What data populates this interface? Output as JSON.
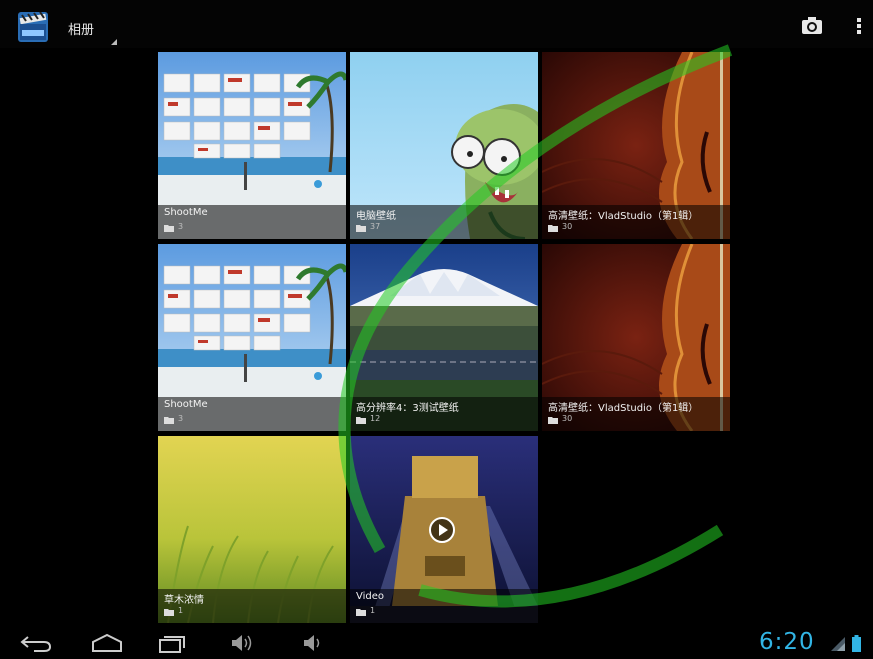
{
  "actionbar": {
    "title": "相册",
    "icons": {
      "app": "clapperboard-app-icon",
      "camera": "camera-icon",
      "overflow": "overflow-menu-icon"
    }
  },
  "albums": [
    {
      "title": "ShootMe",
      "count": "3",
      "art": "screenshot-beach"
    },
    {
      "title": "电脑壁纸",
      "count": "37",
      "art": "cartoon-robot"
    },
    {
      "title": "高清壁纸：VladStudio（第1辑）",
      "count": "30",
      "art": "violin"
    },
    {
      "title": "ShootMe",
      "count": "3",
      "art": "screenshot-beach"
    },
    {
      "title": "高分辨率4：3测试壁纸",
      "count": "12",
      "art": "mount-fuji"
    },
    {
      "title": "高清壁纸：VladStudio（第1辑）",
      "count": "30",
      "art": "violin"
    },
    {
      "title": "草木浓情",
      "count": "1",
      "art": "grass"
    },
    {
      "title": "Video",
      "count": "1",
      "art": "fox-logo",
      "is_video": true
    }
  ],
  "navbar": {
    "icons": [
      "back-icon",
      "home-icon",
      "recent-apps-icon",
      "volume-up-icon",
      "volume-down-icon"
    ],
    "clock": "6:20",
    "accent": "#32b5e5"
  },
  "colors": {
    "background": "#000000",
    "accent": "#32b5e5",
    "watermark": "#22cc22"
  }
}
